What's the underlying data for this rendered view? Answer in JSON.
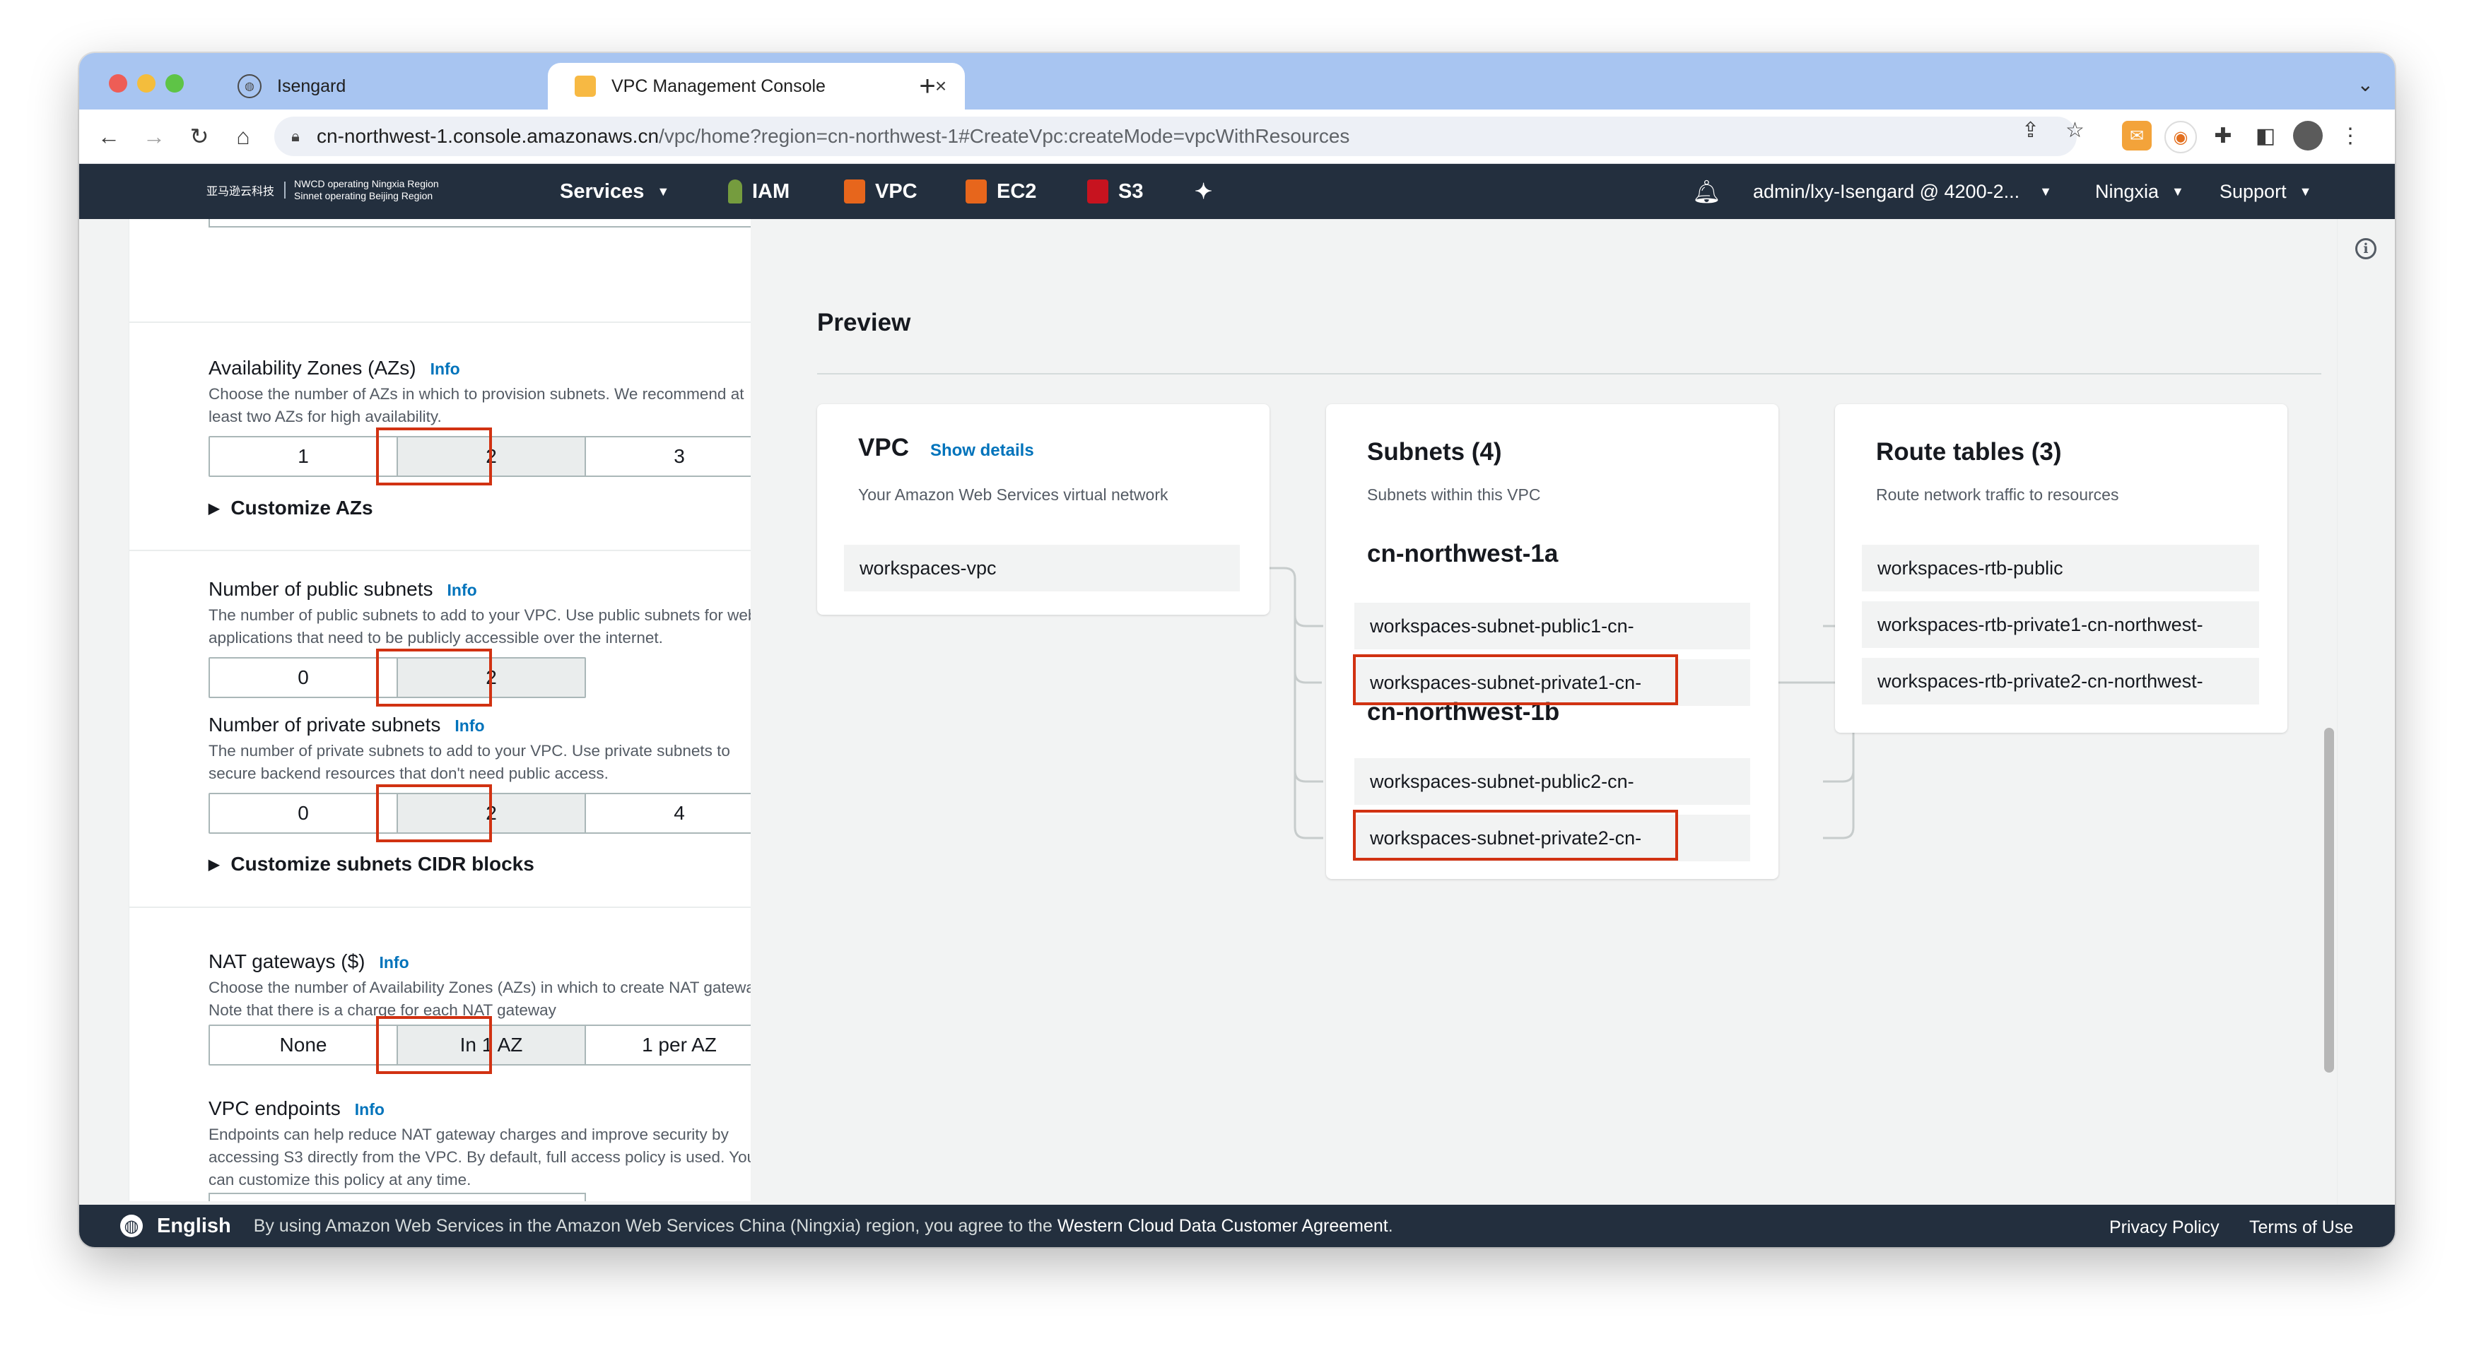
{
  "browser": {
    "tabs": [
      {
        "label": "Isengard",
        "icon": "globe-icon"
      },
      {
        "label": "VPC Management Console",
        "icon": "aws-cube-icon"
      }
    ],
    "url_host": "cn-northwest-1.console.amazonaws.cn",
    "url_path": "/vpc/home?region=cn-northwest-1#CreateVpc:createMode=vpcWithResources"
  },
  "awsnav": {
    "logo_cn": "亚马逊云科技",
    "logo_line1": "NWCD operating Ningxia Region",
    "logo_line2": "Sinnet operating Beijing Region",
    "services_label": "Services",
    "shortcuts": [
      {
        "label": "IAM",
        "color": "#759c3e"
      },
      {
        "label": "VPC",
        "color": "#e7661c"
      },
      {
        "label": "EC2",
        "color": "#e7661c"
      },
      {
        "label": "S3",
        "color": "#c7131f"
      }
    ],
    "account": "admin/lxy-Isengard @ 4200-2...",
    "region": "Ningxia",
    "support": "Support"
  },
  "form": {
    "azs": {
      "label": "Availability Zones (AZs)",
      "info": "Info",
      "description": "Choose the number of AZs in which to provision subnets. We recommend at least two AZs for high availability.",
      "options": [
        "1",
        "2",
        "3"
      ],
      "selected": "2"
    },
    "customize_azs": "Customize AZs",
    "public_subnets": {
      "label": "Number of public subnets",
      "info": "Info",
      "description": "The number of public subnets to add to your VPC. Use public subnets for web applications that need to be publicly accessible over the internet.",
      "options": [
        "0",
        "2"
      ],
      "selected": "2"
    },
    "private_subnets": {
      "label": "Number of private subnets",
      "info": "Info",
      "description": "The number of private subnets to add to your VPC. Use private subnets to secure backend resources that don't need public access.",
      "options": [
        "0",
        "2",
        "4"
      ],
      "selected": "2"
    },
    "customize_cidr": "Customize subnets CIDR blocks",
    "nat": {
      "label": "NAT gateways ($)",
      "info": "Info",
      "description": "Choose the number of Availability Zones (AZs) in which to create NAT gateways. Note that there is a charge for each NAT gateway",
      "options": [
        "None",
        "In 1 AZ",
        "1 per AZ"
      ],
      "selected": "In 1 AZ"
    },
    "endpoints": {
      "label": "VPC endpoints",
      "info": "Info",
      "description": "Endpoints can help reduce NAT gateway charges and improve security by accessing S3 directly from the VPC. By default, full access policy is used. You can customize this policy at any time."
    }
  },
  "preview": {
    "title": "Preview",
    "vpc": {
      "title": "VPC",
      "link": "Show details",
      "subtitle": "Your Amazon Web Services virtual network",
      "name": "workspaces-vpc"
    },
    "subnets": {
      "title": "Subnets (4)",
      "subtitle": "Subnets within this VPC",
      "az1": "cn-northwest-1a",
      "az1_items": [
        "workspaces-subnet-public1-cn-",
        "workspaces-subnet-private1-cn-"
      ],
      "az2": "cn-northwest-1b",
      "az2_items": [
        "workspaces-subnet-public2-cn-",
        "workspaces-subnet-private2-cn-"
      ]
    },
    "routes": {
      "title": "Route tables (3)",
      "subtitle": "Route network traffic to resources",
      "items": [
        "workspaces-rtb-public",
        "workspaces-rtb-private1-cn-northwest-",
        "workspaces-rtb-private2-cn-northwest-"
      ]
    }
  },
  "footer": {
    "language": "English",
    "legal_prefix": "By using Amazon Web Services in the Amazon Web Services China (Ningxia) region, you agree to the",
    "legal_link": "Western Cloud Data Customer Agreement",
    "legal_suffix": ".",
    "privacy": "Privacy Policy",
    "terms": "Terms of Use"
  }
}
